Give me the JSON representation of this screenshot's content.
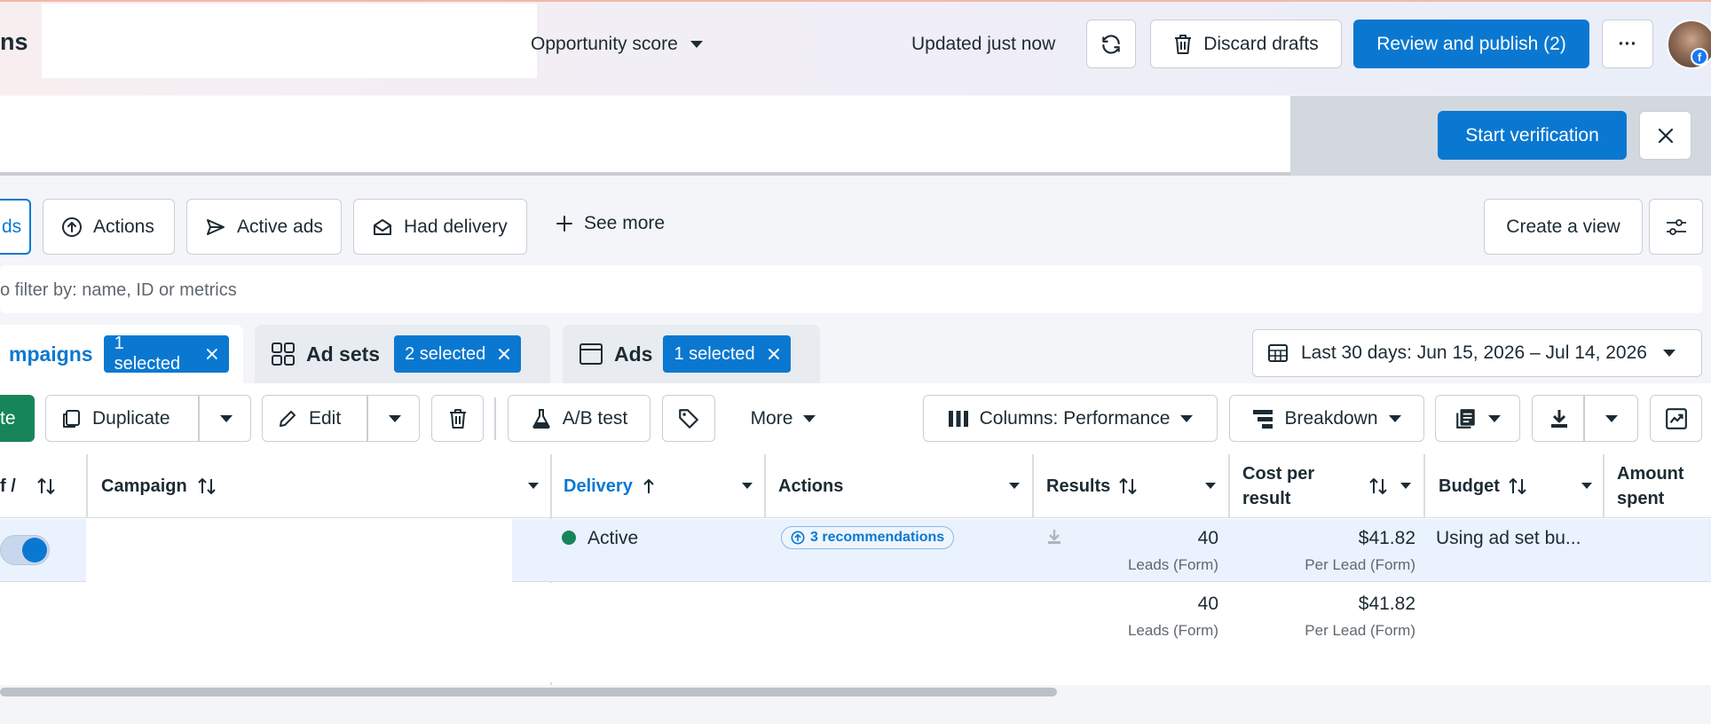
{
  "header": {
    "app_title_fragment": "ns",
    "opportunity_label": "Opportunity score",
    "updated_text": "Updated just now",
    "discard_label": "Discard drafts",
    "review_label": "Review and publish (2)",
    "more_label": "···",
    "avatar_badge": "f"
  },
  "banner": {
    "verify_label": "Start verification"
  },
  "filters": {
    "chips": [
      {
        "label": "ds",
        "selected": true
      },
      {
        "label": "Actions"
      },
      {
        "label": "Active ads"
      },
      {
        "label": "Had delivery"
      }
    ],
    "see_more_label": "See more",
    "create_view_label": "Create a view"
  },
  "search": {
    "placeholder": "o filter by: name, ID or metrics"
  },
  "levels": {
    "campaigns": {
      "label": "mpaigns",
      "selected": "1 selected"
    },
    "adsets": {
      "label": "Ad sets",
      "selected": "2 selected"
    },
    "ads": {
      "label": "Ads",
      "selected": "1 selected"
    },
    "date_range": "Last 30 days: Jun 15, 2026 – Jul 14, 2026"
  },
  "toolbar": {
    "create_fragment": "te",
    "duplicate_label": "Duplicate",
    "edit_label": "Edit",
    "ab_test_label": "A/B test",
    "more_label": "More",
    "columns_label": "Columns: Performance",
    "breakdown_label": "Breakdown"
  },
  "table": {
    "headers": {
      "offon": "f /",
      "campaign": "Campaign",
      "delivery": "Delivery",
      "actions": "Actions",
      "results": "Results",
      "cost_line1": "Cost per",
      "cost_line2": "result",
      "budget": "Budget",
      "amount_line1": "Amount",
      "amount_line2": "spent"
    },
    "rows": [
      {
        "delivery": "Active",
        "recommendations": "3 recommendations",
        "results": "40",
        "results_sub": "Leads (Form)",
        "cost": "$41.82",
        "cost_sub": "Per Lead (Form)",
        "budget": "Using ad set bu..."
      }
    ],
    "totals": {
      "results": "40",
      "results_sub": "Leads (Form)",
      "cost": "$41.82",
      "cost_sub": "Per Lead (Form)"
    }
  },
  "colors": {
    "primary": "#0a78d1",
    "active_green": "#16855a",
    "row_highlight": "#e9f2fd"
  }
}
